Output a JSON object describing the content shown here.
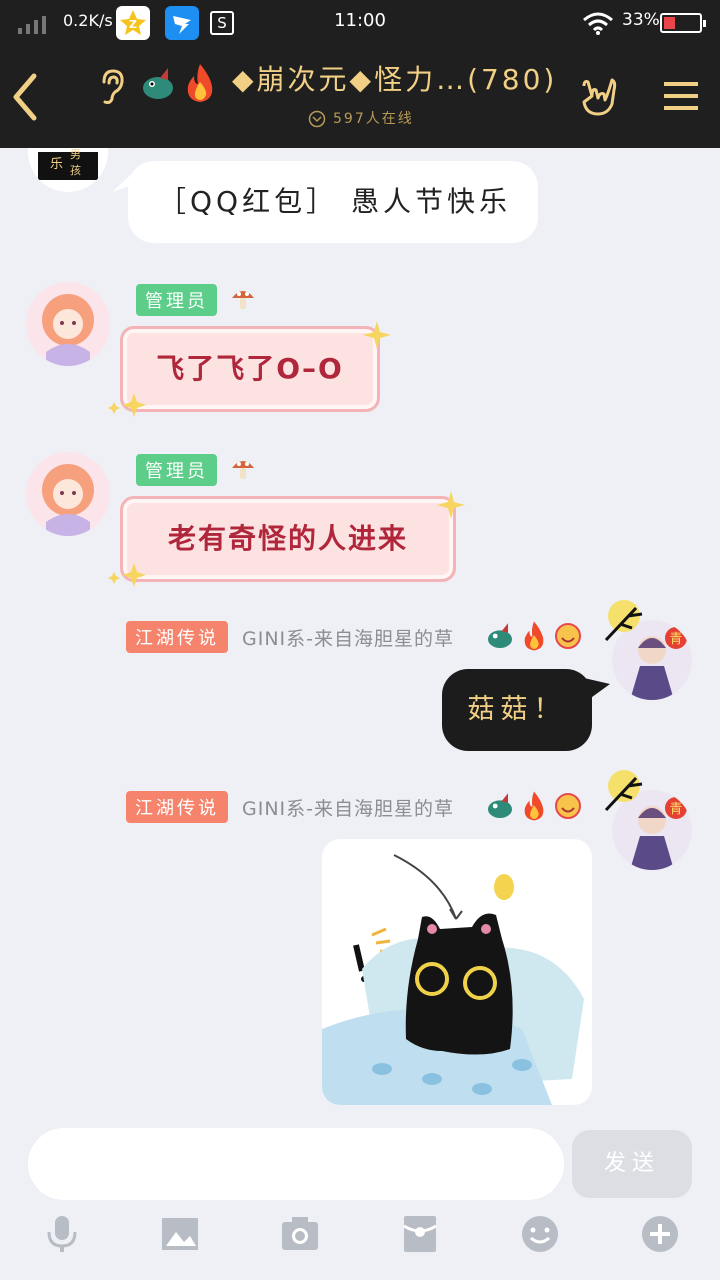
{
  "status_bar": {
    "net_speed": "0.2K/s",
    "time": "11:00",
    "battery_percent": "33%",
    "battery_level": 0.33
  },
  "header": {
    "title": "◆崩次元◆怪力…(780)",
    "online": "597人在线"
  },
  "messages": [
    {
      "text": "［QQ红包］ 愚人节快乐"
    },
    {
      "tag": "管理员",
      "text": "飞了飞了O–O"
    },
    {
      "tag": "管理员",
      "text": "老有奇怪的人进来"
    },
    {
      "tag": "江湖传说",
      "nickname": "GINI系-来自海胆星的草",
      "avatar_badge": "青",
      "text": "菇菇！"
    },
    {
      "tag": "江湖传说",
      "nickname": "GINI系-来自海胆星的草",
      "avatar_badge": "青",
      "sticker": "black-cat-sticker"
    }
  ],
  "input": {
    "placeholder": "",
    "send_label": "发送"
  },
  "colors": {
    "header_bg": "#1f1f1f",
    "gold": "#f1cf85",
    "admin_tag": "#5dcd8a",
    "rank_tag": "#f6836b",
    "chat_bg": "#eef0f5"
  }
}
